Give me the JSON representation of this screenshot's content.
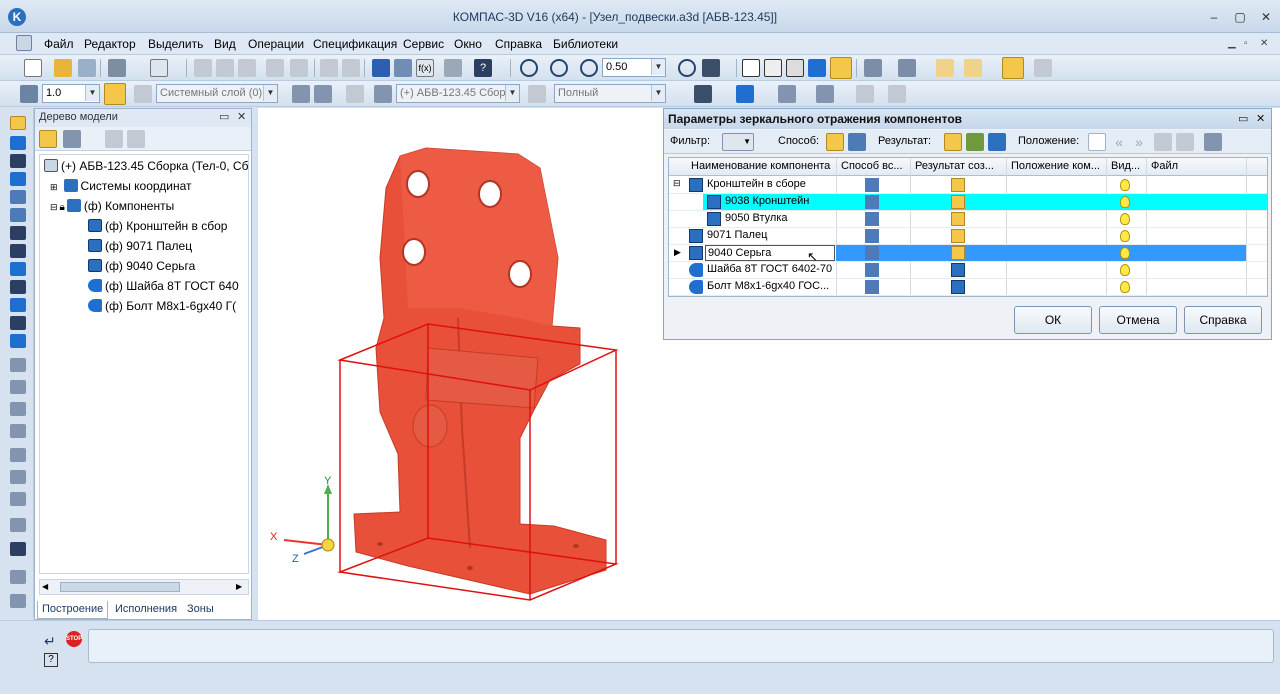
{
  "window": {
    "title": "КОМПАС-3D V16  (x64) - [Узел_подвески.a3d [АБВ-123.45]]",
    "logo_letter": "K",
    "controls": [
      "–",
      "▢",
      "✕"
    ]
  },
  "menu": {
    "items": [
      "Файл",
      "Редактор",
      "Выделить",
      "Вид",
      "Операции",
      "Спецификация",
      "Сервис",
      "Окно",
      "Справка",
      "Библиотеки"
    ]
  },
  "toolbar1": {
    "zoom_value": "0.50"
  },
  "toolbar2": {
    "step_value": "1.0",
    "layer_value": "Системный слой (0)",
    "component_value": "(+) АБВ-123.45 Сбор",
    "display_value": "Полный"
  },
  "tree_panel": {
    "title": "Дерево модели",
    "nodes": [
      "(+) АБВ-123.45 Сборка (Тел-0, Сб",
      "Системы координат",
      "(ф) Компоненты",
      "(ф) Кронштейн в сбор",
      "(ф) 9071 Палец",
      "(ф) 9040 Серьга",
      "(ф) Шайба 8Т ГОСТ 640",
      "(ф) Болт М8х1-6gх40 Г("
    ],
    "tabs": [
      "Построение",
      "Исполнения",
      "Зоны"
    ]
  },
  "axes": {
    "x": "X",
    "y": "Y",
    "z": "Z"
  },
  "dialog": {
    "title": "Параметры зеркального отражения компонентов",
    "filter_label": "Фильтр:",
    "method_label": "Способ:",
    "result_label": "Результат:",
    "position_label": "Положение:",
    "columns": [
      "Наименование компонента",
      "Способ вс...",
      "Результат соз...",
      "Положение ком...",
      "Вид...",
      "Файл"
    ],
    "rows": [
      {
        "name": "Кронштейн в сборе",
        "state": "normal"
      },
      {
        "name": "9038 Кронштейн",
        "state": "cyan"
      },
      {
        "name": "9050 Втулка",
        "state": "normal"
      },
      {
        "name": "9071 Палец",
        "state": "normal"
      },
      {
        "name": "9040 Серьга",
        "state": "selected"
      },
      {
        "name": "Шайба 8Т ГОСТ 6402-70",
        "state": "normal"
      },
      {
        "name": "Болт М8х1-6gх40 ГОС...",
        "state": "normal"
      }
    ],
    "ok_label": "ОК",
    "cancel_label": "Отмена",
    "help_label": "Справка"
  },
  "colors": {
    "model": "#e8503a",
    "bbox": "#e01010",
    "row_cyan": "#00ffff",
    "row_selected": "#3399ff"
  }
}
